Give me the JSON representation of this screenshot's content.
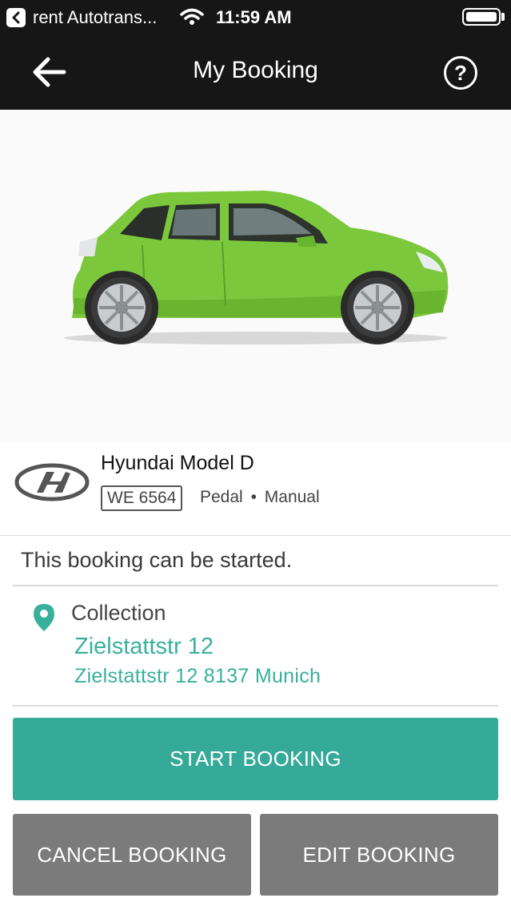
{
  "status_bar": {
    "app_label": "rent Autotrans...",
    "time": "11:59 AM"
  },
  "nav": {
    "title": "My Booking",
    "help_glyph": "?"
  },
  "vehicle": {
    "model": "Hyundai Model D",
    "plate": "WE 6564",
    "fuel": "Pedal",
    "separator": "•",
    "transmission": "Manual",
    "car_color": "#7cc83d"
  },
  "booking": {
    "status_text": "This booking can be started.",
    "location_label": "Collection",
    "location_name": "Zielstattstr 12",
    "location_address": "Zielstattstr 12 8137 Munich"
  },
  "actions": {
    "start_label": "START BOOKING",
    "cancel_label": "CANCEL BOOKING",
    "edit_label": "EDIT BOOKING"
  },
  "colors": {
    "accent": "#36aa98",
    "link": "#38b09c",
    "secondary_button": "#7b7b7b",
    "header": "#161616"
  }
}
